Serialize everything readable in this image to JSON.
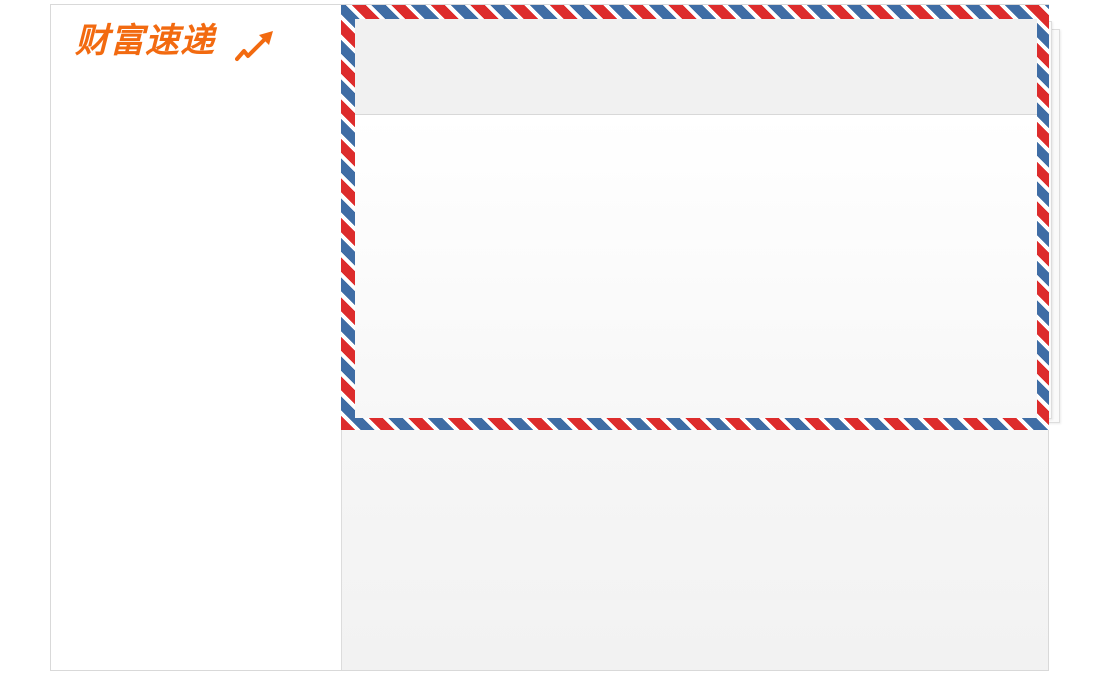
{
  "brand": {
    "name": "财富速递",
    "icon": "rising-arrow-icon",
    "color": "#f26a10"
  },
  "envelope": {
    "stripe_colors": [
      "#dd2c2c",
      "#3f6da5"
    ]
  }
}
